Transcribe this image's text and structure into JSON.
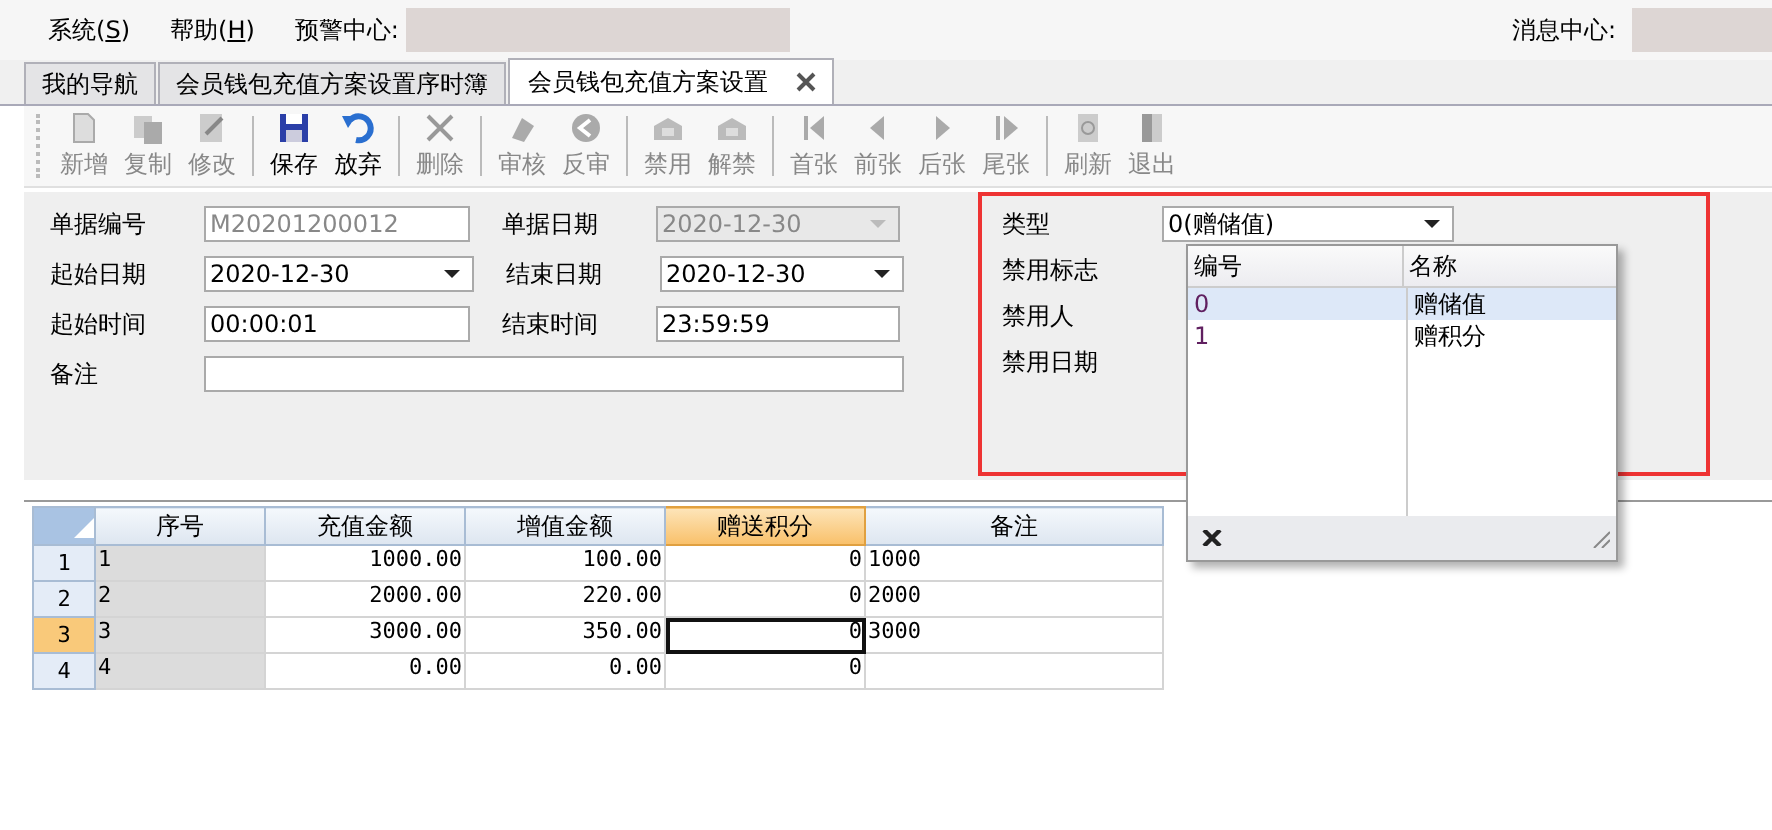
{
  "menu": [
    {
      "label": "系统(S)"
    },
    {
      "label": "帮助(H)"
    }
  ],
  "alert_center": {
    "label": "预警中心:"
  },
  "message_center": {
    "label": "消息中心:"
  },
  "tabs": [
    {
      "label": "我的导航",
      "selected": false
    },
    {
      "label": "会员钱包充值方案设置序时簿",
      "selected": false
    },
    {
      "label": "会员钱包充值方案设置",
      "selected": true
    }
  ],
  "toolbar": [
    {
      "label": "新增",
      "disabled": true
    },
    {
      "label": "复制",
      "disabled": true
    },
    {
      "label": "修改",
      "disabled": true
    },
    {
      "label": "保存",
      "disabled": false
    },
    {
      "label": "放弃",
      "disabled": false
    },
    {
      "label": "删除",
      "disabled": true
    },
    {
      "label": "审核",
      "disabled": true
    },
    {
      "label": "反审",
      "disabled": true
    },
    {
      "label": "禁用",
      "disabled": true
    },
    {
      "label": "解禁",
      "disabled": true
    },
    {
      "label": "首张",
      "disabled": true
    },
    {
      "label": "前张",
      "disabled": true
    },
    {
      "label": "后张",
      "disabled": true
    },
    {
      "label": "尾张",
      "disabled": true
    },
    {
      "label": "刷新",
      "disabled": true
    },
    {
      "label": "退出",
      "disabled": true
    }
  ],
  "form": [
    {
      "label": "单据编号",
      "kind": "text",
      "value": "M20201200012",
      "disabled": true
    },
    {
      "label": "单据日期",
      "kind": "date",
      "value": "2020-12-30",
      "disabled": true
    },
    {
      "label": "起始日期",
      "kind": "date",
      "value": "2020-12-30",
      "disabled": false
    },
    {
      "label": "结束日期",
      "kind": "date",
      "value": "2020-12-30",
      "disabled": false
    },
    {
      "label": "起始时间",
      "kind": "text",
      "value": "00:00:01",
      "disabled": false
    },
    {
      "label": "结束时间",
      "kind": "text",
      "value": "23:59:59",
      "disabled": false
    },
    {
      "label": "备注",
      "kind": "wide",
      "disabled": false
    }
  ],
  "side_form": {
    "type_label": "类型",
    "type_value": "0(赠储值)",
    "labels": [
      "禁用标志",
      "禁用人",
      "禁用日期"
    ]
  },
  "dropdown": {
    "columns": [
      "编号",
      "名称"
    ],
    "items": [
      {
        "code": "0",
        "name": "赠储值",
        "selected": true
      },
      {
        "code": "1",
        "name": "赠积分",
        "selected": false
      }
    ]
  },
  "table": {
    "columns": [
      {
        "label": "序号",
        "selected": false
      },
      {
        "label": "充值金额",
        "selected": false
      },
      {
        "label": "增值金额",
        "selected": false
      },
      {
        "label": "赠送积分",
        "selected": true
      },
      {
        "label": "备注",
        "selected": false
      }
    ],
    "rows": [
      {
        "number": "1",
        "selected": false,
        "cells": [
          "1",
          "1000.00",
          "100.00",
          "0",
          "1000"
        ]
      },
      {
        "number": "2",
        "selected": false,
        "cells": [
          "2",
          "2000.00",
          "220.00",
          "0",
          "2000"
        ]
      },
      {
        "number": "3",
        "selected": true,
        "cells": [
          "3",
          "3000.00",
          "350.00",
          "0",
          "3000"
        ]
      },
      {
        "number": "4",
        "selected": false,
        "cells": [
          "4",
          "0.00",
          "0.00",
          "0",
          ""
        ]
      }
    ]
  }
}
